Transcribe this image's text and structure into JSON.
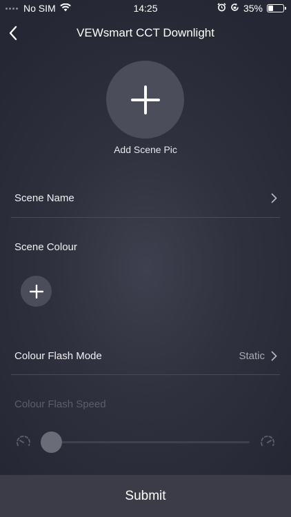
{
  "status": {
    "carrier": "No SIM",
    "time": "14:25",
    "battery": "35%",
    "battery_level": 0.35
  },
  "nav": {
    "title": "VEWsmart CCT Downlight"
  },
  "scene_pic": {
    "label": "Add Scene Pic"
  },
  "scene_name": {
    "label": "Scene Name"
  },
  "scene_colour": {
    "label": "Scene Colour"
  },
  "flash_mode": {
    "label": "Colour Flash Mode",
    "value": "Static"
  },
  "flash_speed": {
    "label": "Colour Flash Speed",
    "level": 0.0
  },
  "submit": {
    "label": "Submit"
  },
  "colors": {
    "background": "#2f313e",
    "circle": "#4c4d5b",
    "submit_bar": "#3b3c48",
    "disabled_text": "#5c5e6a"
  }
}
